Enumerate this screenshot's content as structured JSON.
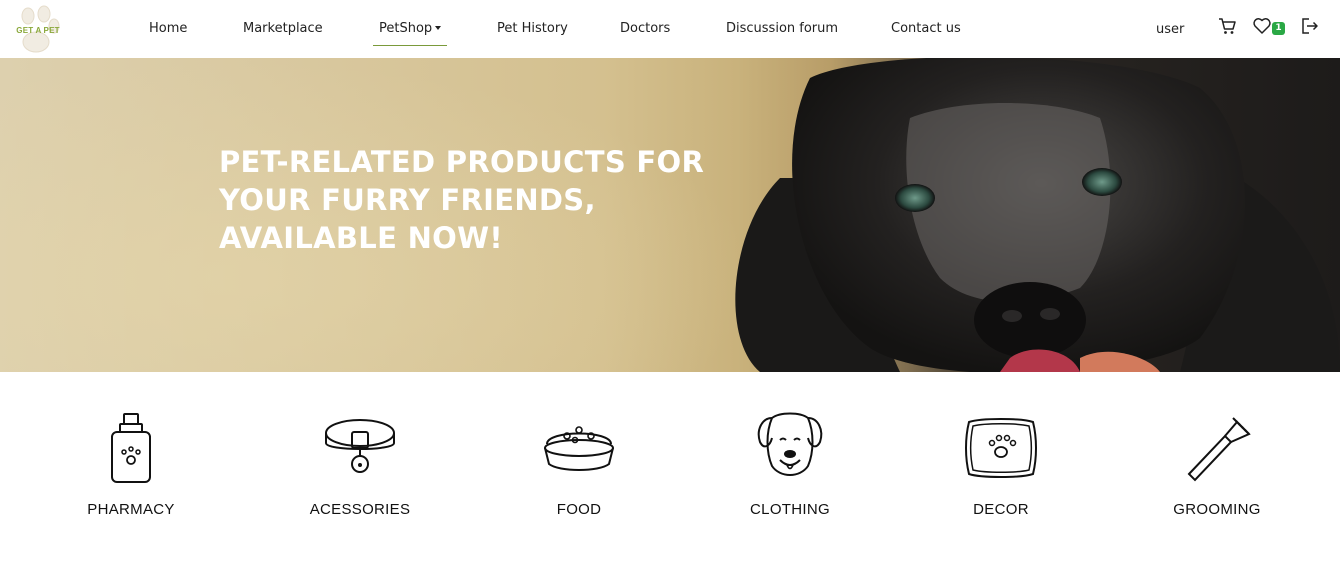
{
  "brand": {
    "logo_text": "GET A PET"
  },
  "nav": {
    "home": "Home",
    "marketplace": "Marketplace",
    "petshop": "PetShop",
    "pet_history": "Pet History",
    "doctors": "Doctors",
    "forum": "Discussion forum",
    "contact": "Contact us"
  },
  "header_right": {
    "user": "user",
    "wishlist_count": "1",
    "icons": [
      "cart-icon",
      "heart-icon",
      "logout-icon"
    ]
  },
  "hero": {
    "title": "PET-RELATED PRODUCTS FOR YOUR FURRY FRIENDS, AVAILABLE NOW!"
  },
  "categories": [
    {
      "label": "PHARMACY",
      "icon": "pharmacy-bottle-icon"
    },
    {
      "label": "ACESSORIES",
      "icon": "collar-icon"
    },
    {
      "label": "FOOD",
      "icon": "food-bowl-icon"
    },
    {
      "label": "CLOTHING",
      "icon": "dog-face-icon"
    },
    {
      "label": "DECOR",
      "icon": "pet-bed-icon"
    },
    {
      "label": "GROOMING",
      "icon": "brush-icon"
    }
  ],
  "colors": {
    "accent": "#7a9a3a",
    "badge": "#2aa845",
    "logo": "#8aa83a"
  }
}
